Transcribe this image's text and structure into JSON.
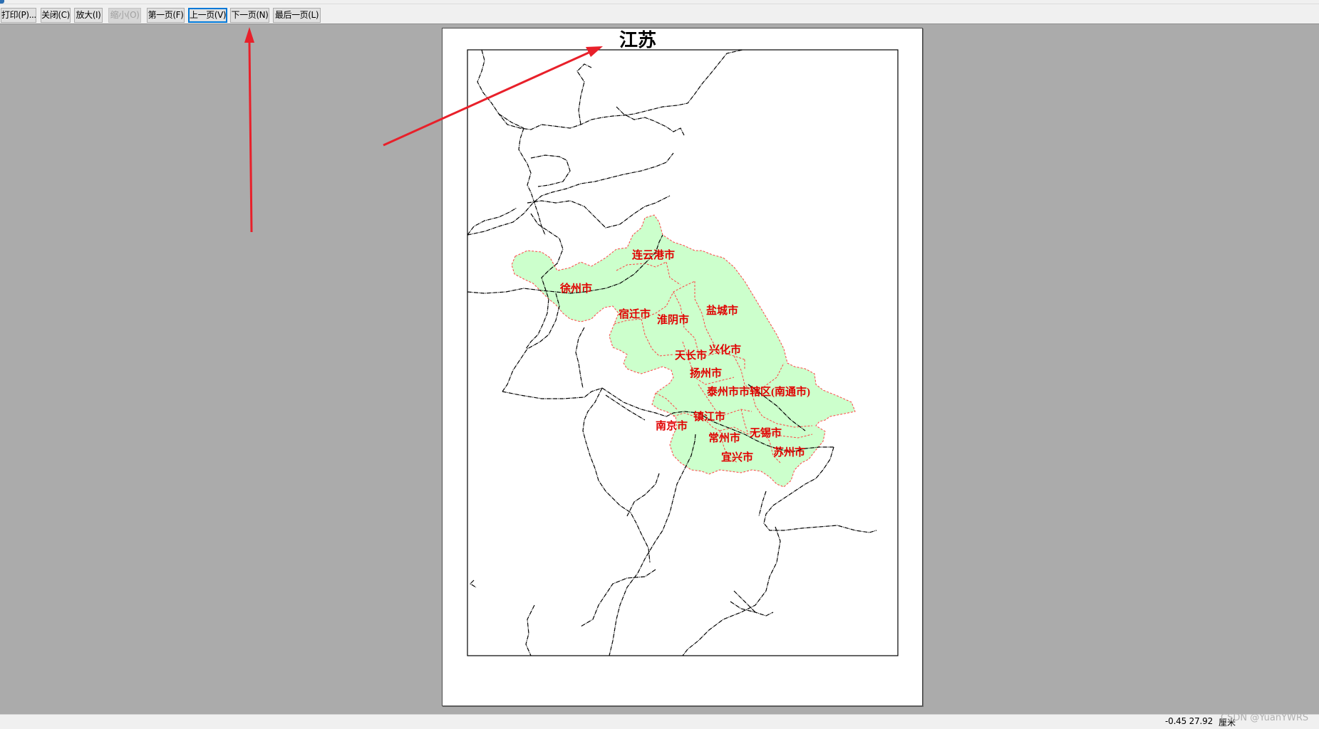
{
  "toolbar": {
    "print": "打印(P)...",
    "close": "关闭(C)",
    "zoom_in": "放大(I)",
    "zoom_out": "缩小(O)",
    "first_page": "第一页(F)",
    "prev_page": "上一页(V)",
    "next_page": "下一页(N)",
    "last_page": "最后一页(L)"
  },
  "map": {
    "title": "江苏",
    "cities": {
      "lianyungang": "连云港市",
      "xuzhou": "徐州市",
      "suqian": "宿迁市",
      "huaiyin": "淮阴市",
      "yancheng": "盐城市",
      "xinghua": "兴化市",
      "tianchang": "天长市",
      "yangzhou": "扬州市",
      "taizhou_nantong": "泰州市市辖区(南通市)",
      "zhenjiang": "镇江市",
      "nanjing": "南京市",
      "changzhou": "常州市",
      "wuxi": "无锡市",
      "yixing": "宜兴市",
      "suzhou": "苏州市"
    },
    "colors": {
      "region_fill": "#ccffcc",
      "boundary": "#ff4444",
      "label": "#e00000",
      "rail": "#000000"
    }
  },
  "annotations": {
    "arrow_color": "#e8202a"
  },
  "status": {
    "coordinates": "-0.45  27.92",
    "unit": "厘米",
    "watermark": "CSDN @YuanYWRS"
  }
}
